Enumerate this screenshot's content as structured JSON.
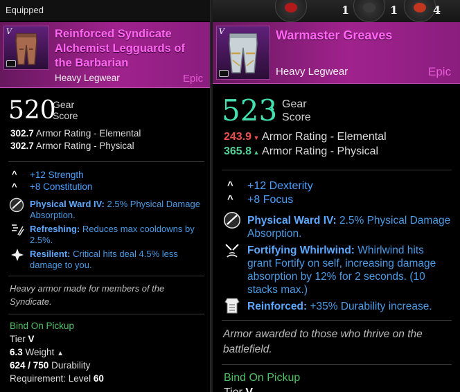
{
  "equipped_panel": {
    "label": "Equipped",
    "item_name": "Reinforced Syndicate Alchemist Legguards of the Barbarian",
    "tier_numeral": "V",
    "item_type": "Heavy Legwear",
    "rarity": "Epic",
    "gear_score": "520",
    "gear_score_label": "Gear Score",
    "armor": [
      {
        "value": "302.7",
        "label": "Armor Rating - Elemental"
      },
      {
        "value": "302.7",
        "label": "Armor Rating - Physical"
      }
    ],
    "attributes": [
      "+12 Strength",
      "+8 Constitution"
    ],
    "perks": [
      {
        "icon": "physical-ward-icon",
        "name": "Physical Ward IV:",
        "desc": "2.5% Physical Damage Absorption."
      },
      {
        "icon": "refreshing-icon",
        "name": "Refreshing:",
        "desc": "Reduces max cooldowns by 2.5%."
      },
      {
        "icon": "resilient-icon",
        "name": "Resilient:",
        "desc": "Critical hits deal 4.5% less damage to you."
      }
    ],
    "flavor": "Heavy armor made for members of the Syndicate.",
    "bind": "Bind On Pickup",
    "tier_label": "Tier",
    "tier_value": "V",
    "weight_value": "6.3",
    "weight_label": "Weight",
    "durability_value": "624 / 750",
    "durability_label": "Durability",
    "requirement_label": "Requirement: Level",
    "requirement_value": "60"
  },
  "compare_panel": {
    "slot_counts": [
      "1",
      "1",
      "4"
    ],
    "item_name": "Warmaster Greaves",
    "tier_numeral": "V",
    "item_type": "Heavy Legwear",
    "rarity": "Epic",
    "gear_score": "523",
    "gear_score_label": "Gear Score",
    "armor": [
      {
        "value": "243.9",
        "label": "Armor Rating - Elemental",
        "trend": "down",
        "color": "#ee5050"
      },
      {
        "value": "365.8",
        "label": "Armor Rating - Physical",
        "trend": "up",
        "color": "#52cf95"
      }
    ],
    "attributes": [
      "+12 Dexterity",
      "+8 Focus"
    ],
    "perks": [
      {
        "icon": "physical-ward-icon",
        "name": "Physical Ward IV:",
        "desc": "2.5% Physical Damage Absorption."
      },
      {
        "icon": "fortifying-whirlwind-icon",
        "name": "Fortifying Whirlwind:",
        "desc": "Whirlwind hits grant Fortify on self, increasing damage absorption by 12% for 2 seconds. (10 stacks max.)"
      },
      {
        "icon": "reinforced-icon",
        "name": "Reinforced:",
        "desc": "+35% Durability increase."
      }
    ],
    "flavor": "Armor awarded to those who thrive on the battlefield.",
    "bind": "Bind On Pickup",
    "tier_label": "Tier",
    "tier_value": "V"
  },
  "colors": {
    "item_name": "#ff67f2",
    "rarity": "#e85bd9",
    "gear_score_up": "#43e0b0",
    "stat_up": "#52cf95",
    "stat_down": "#ee5050",
    "attribute_blue": "#4aa0ff",
    "bind_green": "#4ec265"
  }
}
